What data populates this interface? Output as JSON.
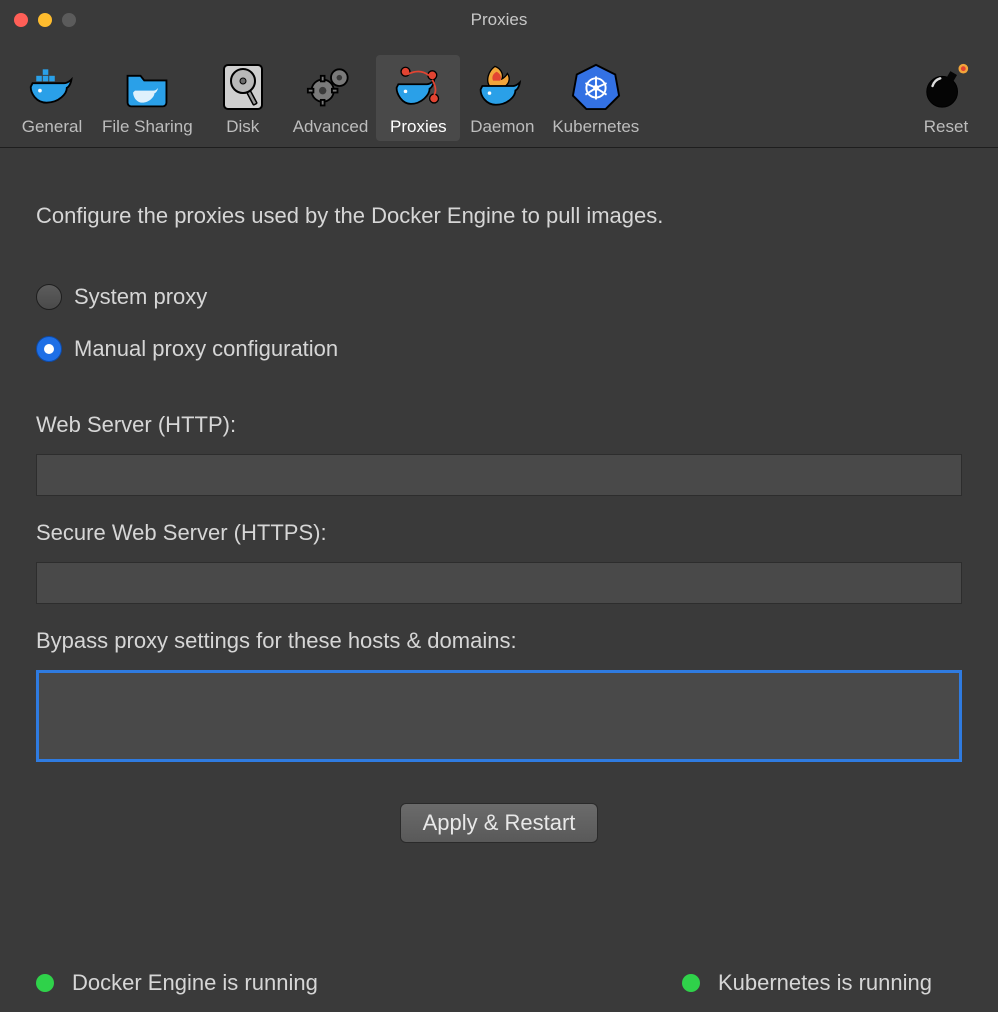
{
  "window": {
    "title": "Proxies"
  },
  "toolbar": {
    "items": [
      {
        "label": "General"
      },
      {
        "label": "File Sharing"
      },
      {
        "label": "Disk"
      },
      {
        "label": "Advanced"
      },
      {
        "label": "Proxies"
      },
      {
        "label": "Daemon"
      },
      {
        "label": "Kubernetes"
      }
    ],
    "reset": {
      "label": "Reset"
    },
    "active_index": 4
  },
  "content": {
    "intro": "Configure the proxies used by the Docker Engine to pull images.",
    "proxy_mode": {
      "system_label": "System proxy",
      "manual_label": "Manual proxy configuration",
      "selected": "manual"
    },
    "http": {
      "label": "Web Server (HTTP):",
      "value": ""
    },
    "https": {
      "label": "Secure Web Server (HTTPS):",
      "value": ""
    },
    "bypass": {
      "label": "Bypass proxy settings for these hosts & domains:",
      "value": ""
    },
    "apply_label": "Apply & Restart"
  },
  "status": {
    "docker": "Docker Engine is running",
    "kubernetes": "Kubernetes is running"
  }
}
